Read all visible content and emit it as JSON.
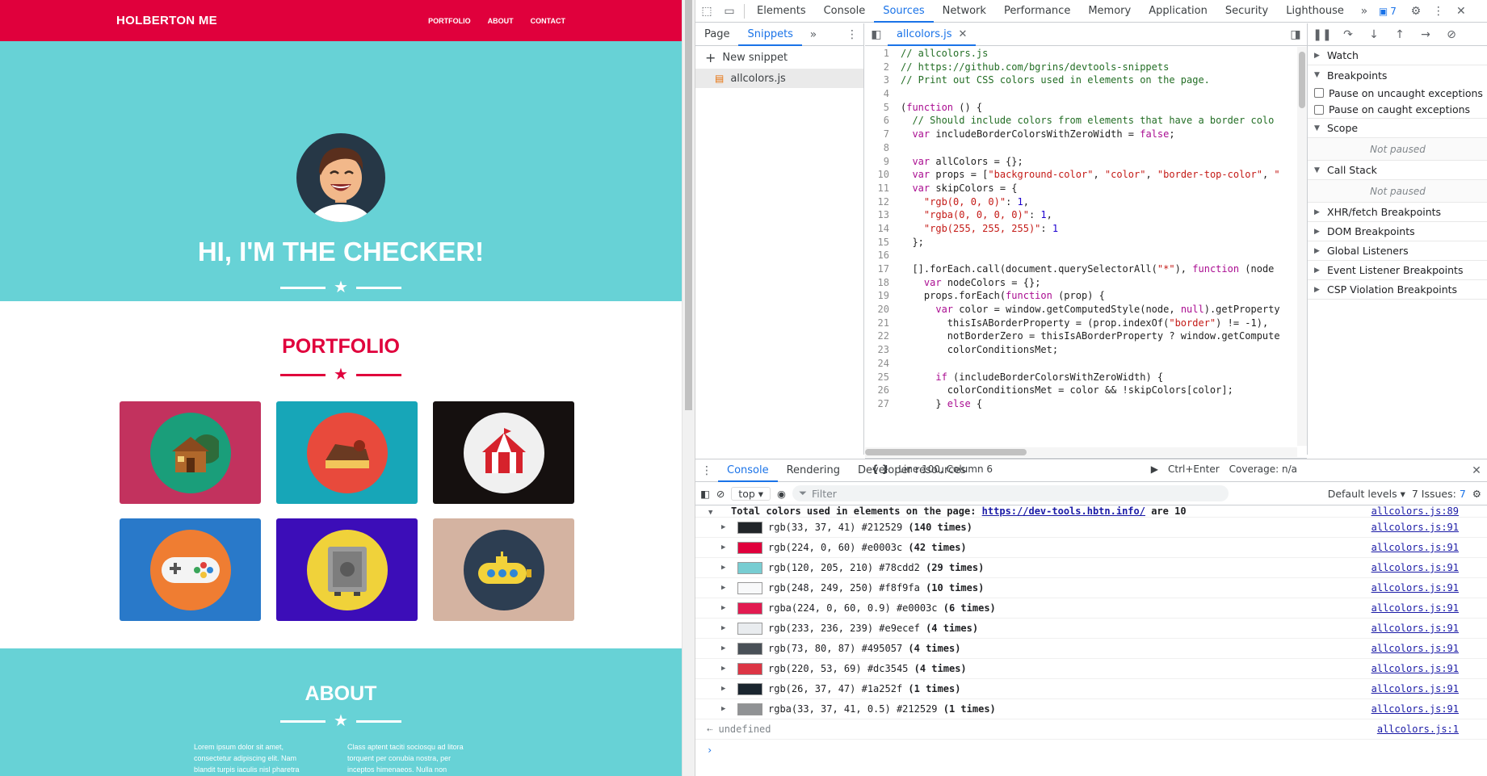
{
  "site": {
    "brand": "HOLBERTON ME",
    "nav": [
      "PORTFOLIO",
      "ABOUT",
      "CONTACT"
    ],
    "hero_title": "HI, I'M THE CHECKER!",
    "portfolio_title": "PORTFOLIO",
    "about_title": "ABOUT",
    "about_col1": "Lorem ipsum dolor sit amet, consectetur adipiscing elit. Nam blandit turpis iaculis nisl pharetra auctor. Phasellus mattis",
    "about_col2": "Class aptent taciti sociosqu ad litora torquent per conubia nostra, per inceptos himenaeos. Nulla non ornare",
    "tiles": [
      {
        "bg": "#c2325e",
        "circle": "#1a9e7a",
        "icon": "cabin-icon"
      },
      {
        "bg": "#17a6b8",
        "circle": "#e84a3c",
        "icon": "cake-icon"
      },
      {
        "bg": "#15100f",
        "circle": "#f0f0f0",
        "icon": "circus-tent-icon"
      },
      {
        "bg": "#2979c9",
        "circle": "#ef7d32",
        "icon": "gamepad-icon"
      },
      {
        "bg": "#3c0db8",
        "circle": "#f0d23a",
        "icon": "safe-icon"
      },
      {
        "bg": "#d4b3a1",
        "circle": "#2d3e52",
        "icon": "submarine-icon"
      }
    ]
  },
  "devtools": {
    "tabs": [
      "Elements",
      "Console",
      "Sources",
      "Network",
      "Performance",
      "Memory",
      "Application",
      "Security",
      "Lighthouse"
    ],
    "active_tab": "Sources",
    "issues_count": "7",
    "nav_tabs": [
      "Page",
      "Snippets"
    ],
    "new_snippet": "New snippet",
    "snippet_file": "allcolors.js",
    "editor_tab": "allcolors.js",
    "status_position": "Line 100, Column 6",
    "run_hint": "Ctrl+Enter",
    "coverage": "Coverage: n/a",
    "sections": {
      "watch": "Watch",
      "breakpoints": "Breakpoints",
      "pause_uncaught": "Pause on uncaught exceptions",
      "pause_caught": "Pause on caught exceptions",
      "scope": "Scope",
      "not_paused_1": "Not paused",
      "call_stack": "Call Stack",
      "not_paused_2": "Not paused",
      "xhr": "XHR/fetch Breakpoints",
      "dom": "DOM Breakpoints",
      "global": "Global Listeners",
      "event": "Event Listener Breakpoints",
      "csp": "CSP Violation Breakpoints"
    },
    "code_lines": [
      "// allcolors.js",
      "// https://github.com/bgrins/devtools-snippets",
      "// Print out CSS colors used in elements on the page.",
      "",
      "(function () {",
      "  // Should include colors from elements that have a border colo",
      "  var includeBorderColorsWithZeroWidth = false;",
      "",
      "  var allColors = {};",
      "  var props = [\"background-color\", \"color\", \"border-top-color\", \"",
      "  var skipColors = {",
      "    \"rgb(0, 0, 0)\": 1,",
      "    \"rgba(0, 0, 0, 0)\": 1,",
      "    \"rgb(255, 255, 255)\": 1",
      "  };",
      "",
      "  [].forEach.call(document.querySelectorAll(\"*\"), function (node",
      "    var nodeColors = {};",
      "    props.forEach(function (prop) {",
      "      var color = window.getComputedStyle(node, null).getProperty",
      "        thisIsABorderProperty = (prop.indexOf(\"border\") != -1),",
      "        notBorderZero = thisIsABorderProperty ? window.getCompute",
      "        colorConditionsMet;",
      "",
      "      if (includeBorderColorsWithZeroWidth) {",
      "        colorConditionsMet = color && !skipColors[color];",
      "      } else {"
    ],
    "console": {
      "tabs": [
        "Console",
        "Rendering",
        "Developer resources"
      ],
      "context": "top",
      "filter_placeholder": "Filter",
      "levels": "Default levels",
      "issues": "7 Issues:",
      "issues_badge": "7",
      "header_prefix": "Total colors used in elements on the page:",
      "header_url": "https://dev-tools.hbtn.info/",
      "header_suffix": "are 10",
      "header_src": "allcolors.js:89",
      "rows": [
        {
          "swatch": "#212529",
          "text": "rgb(33, 37, 41) #212529",
          "count": "(140 times)",
          "src": "allcolors.js:91"
        },
        {
          "swatch": "#e0003c",
          "text": "rgb(224, 0, 60) #e0003c",
          "count": "(42 times)",
          "src": "allcolors.js:91"
        },
        {
          "swatch": "#78cdd2",
          "text": "rgb(120, 205, 210) #78cdd2",
          "count": "(29 times)",
          "src": "allcolors.js:91"
        },
        {
          "swatch": "#f8f9fa",
          "text": "rgb(248, 249, 250) #f8f9fa",
          "count": "(10 times)",
          "src": "allcolors.js:91"
        },
        {
          "swatch": "#e21a50",
          "text": "rgba(224, 0, 60, 0.9) #e0003c",
          "count": "(6 times)",
          "src": "allcolors.js:91"
        },
        {
          "swatch": "#e9ecef",
          "text": "rgb(233, 236, 239) #e9ecef",
          "count": "(4 times)",
          "src": "allcolors.js:91"
        },
        {
          "swatch": "#495057",
          "text": "rgb(73, 80, 87) #495057",
          "count": "(4 times)",
          "src": "allcolors.js:91"
        },
        {
          "swatch": "#dc3545",
          "text": "rgb(220, 53, 69) #dc3545",
          "count": "(4 times)",
          "src": "allcolors.js:91"
        },
        {
          "swatch": "#1a252f",
          "text": "rgb(26, 37, 47) #1a252f",
          "count": "(1 times)",
          "src": "allcolors.js:91"
        },
        {
          "swatch": "#909294",
          "text": "rgba(33, 37, 41, 0.5) #212529",
          "count": "(1 times)",
          "src": "allcolors.js:91"
        }
      ],
      "result": "undefined",
      "result_src": "allcolors.js:1"
    }
  }
}
